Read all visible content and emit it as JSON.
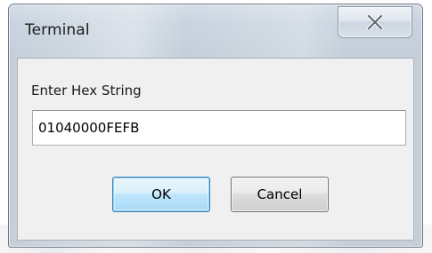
{
  "window": {
    "title": "Terminal",
    "close_icon": "close-x-icon"
  },
  "form": {
    "label": "Enter Hex String",
    "hex_value": "01040000FEFB"
  },
  "buttons": {
    "ok_label": "OK",
    "cancel_label": "Cancel"
  },
  "colors": {
    "ok_button": "#bee6fd",
    "client_area": "#f0f0f0",
    "frame": "#c9d4e0"
  }
}
